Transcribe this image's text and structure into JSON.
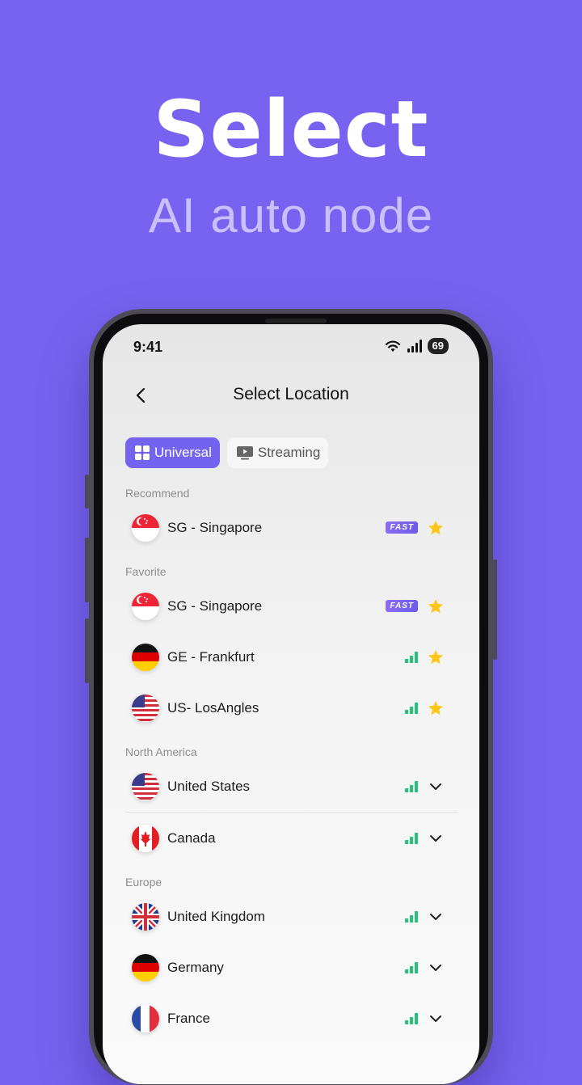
{
  "hero": {
    "title": "Select",
    "subtitle": "AI auto node"
  },
  "status": {
    "time": "9:41",
    "battery": "69"
  },
  "nav": {
    "title": "Select Location"
  },
  "tabs": [
    {
      "label": "Universal",
      "icon": "grid-icon",
      "active": true
    },
    {
      "label": "Streaming",
      "icon": "tv-icon",
      "active": false
    }
  ],
  "sections": {
    "recommend": "Recommend",
    "favorite": "Favorite",
    "north_america": "North America",
    "europe": "Europe"
  },
  "badge": {
    "fast": "FAST"
  },
  "rows": {
    "rec_sg": "SG - Singapore",
    "fav_sg": "SG - Singapore",
    "fav_ge": "GE - Frankfurt",
    "fav_us": "US- LosAngles",
    "na_us": "United States",
    "na_ca": "Canada",
    "eu_uk": "United Kingdom",
    "eu_de": "Germany",
    "eu_fr": "France"
  },
  "colors": {
    "accent": "#7363f0",
    "background": "#7763ef",
    "signal": "#27c27a",
    "star": "#ffc61a"
  }
}
